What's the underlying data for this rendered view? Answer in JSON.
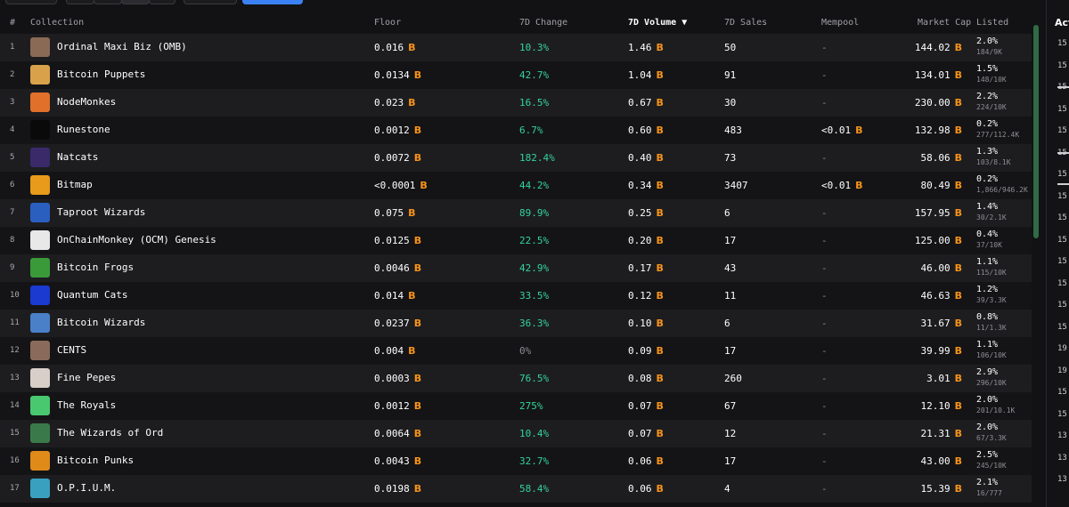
{
  "header": {
    "idx": "#",
    "collection": "Collection",
    "floor": "Floor",
    "change": "7D Change",
    "volume": "7D Volume",
    "sort_arrow": "▼",
    "sales": "7D Sales",
    "mempool": "Mempool",
    "mcap": "Market Cap",
    "listed": "Listed"
  },
  "btc_symbol": "B",
  "rows": [
    {
      "idx": "1",
      "name": "Ordinal Maxi Biz (OMB)",
      "floor": "0.016",
      "change": "10.3%",
      "volume": "1.46",
      "sales": "50",
      "mempool": "-",
      "mcap": "144.02",
      "listed": "2.0%",
      "listed_ratio": "184/9K",
      "thumb": "#8a6a55"
    },
    {
      "idx": "2",
      "name": "Bitcoin Puppets",
      "floor": "0.0134",
      "change": "42.7%",
      "volume": "1.04",
      "sales": "91",
      "mempool": "-",
      "mcap": "134.01",
      "listed": "1.5%",
      "listed_ratio": "148/10K",
      "thumb": "#d9a24a"
    },
    {
      "idx": "3",
      "name": "NodeMonkes",
      "floor": "0.023",
      "change": "16.5%",
      "volume": "0.67",
      "sales": "30",
      "mempool": "-",
      "mcap": "230.00",
      "listed": "2.2%",
      "listed_ratio": "224/10K",
      "thumb": "#e0702a"
    },
    {
      "idx": "4",
      "name": "Runestone",
      "floor": "0.0012",
      "change": "6.7%",
      "volume": "0.60",
      "sales": "483",
      "mempool": "<0.01",
      "mcap": "132.98",
      "listed": "0.2%",
      "listed_ratio": "277/112.4K",
      "thumb": "#0a0a0a"
    },
    {
      "idx": "5",
      "name": "Natcats",
      "floor": "0.0072",
      "change": "182.4%",
      "volume": "0.40",
      "sales": "73",
      "mempool": "-",
      "mcap": "58.06",
      "listed": "1.3%",
      "listed_ratio": "103/8.1K",
      "thumb": "#3a2a6a"
    },
    {
      "idx": "6",
      "name": "Bitmap",
      "floor": "<0.0001",
      "change": "44.2%",
      "volume": "0.34",
      "sales": "3407",
      "mempool": "<0.01",
      "mcap": "80.49",
      "listed": "0.2%",
      "listed_ratio": "1,866/946.2K",
      "thumb": "#e89a1a"
    },
    {
      "idx": "7",
      "name": "Taproot Wizards",
      "floor": "0.075",
      "change": "89.9%",
      "volume": "0.25",
      "sales": "6",
      "mempool": "-",
      "mcap": "157.95",
      "listed": "1.4%",
      "listed_ratio": "30/2.1K",
      "thumb": "#2a5fc0"
    },
    {
      "idx": "8",
      "name": "OnChainMonkey (OCM) Genesis",
      "floor": "0.0125",
      "change": "22.5%",
      "volume": "0.20",
      "sales": "17",
      "mempool": "-",
      "mcap": "125.00",
      "listed": "0.4%",
      "listed_ratio": "37/10K",
      "thumb": "#e8e8e8"
    },
    {
      "idx": "9",
      "name": "Bitcoin Frogs",
      "floor": "0.0046",
      "change": "42.9%",
      "volume": "0.17",
      "sales": "43",
      "mempool": "-",
      "mcap": "46.00",
      "listed": "1.1%",
      "listed_ratio": "115/10K",
      "thumb": "#3a9a3a"
    },
    {
      "idx": "10",
      "name": "Quantum Cats",
      "floor": "0.014",
      "change": "33.5%",
      "volume": "0.12",
      "sales": "11",
      "mempool": "-",
      "mcap": "46.63",
      "listed": "1.2%",
      "listed_ratio": "39/3.3K",
      "thumb": "#1a3ad0"
    },
    {
      "idx": "11",
      "name": "Bitcoin Wizards",
      "floor": "0.0237",
      "change": "36.3%",
      "volume": "0.10",
      "sales": "6",
      "mempool": "-",
      "mcap": "31.67",
      "listed": "0.8%",
      "listed_ratio": "11/1.3K",
      "thumb": "#4a80c8"
    },
    {
      "idx": "12",
      "name": "CENTS",
      "floor": "0.004",
      "change": "0%",
      "volume": "0.09",
      "sales": "17",
      "mempool": "-",
      "mcap": "39.99",
      "listed": "1.1%",
      "listed_ratio": "106/10K",
      "thumb": "#8a6a5a"
    },
    {
      "idx": "13",
      "name": "Fine Pepes",
      "floor": "0.0003",
      "change": "76.5%",
      "volume": "0.08",
      "sales": "260",
      "mempool": "-",
      "mcap": "3.01",
      "listed": "2.9%",
      "listed_ratio": "296/10K",
      "thumb": "#d8d0c8"
    },
    {
      "idx": "14",
      "name": "The Royals",
      "floor": "0.0012",
      "change": "275%",
      "volume": "0.07",
      "sales": "67",
      "mempool": "-",
      "mcap": "12.10",
      "listed": "2.0%",
      "listed_ratio": "201/10.1K",
      "thumb": "#4ac870"
    },
    {
      "idx": "15",
      "name": "The Wizards of Ord",
      "floor": "0.0064",
      "change": "10.4%",
      "volume": "0.07",
      "sales": "12",
      "mempool": "-",
      "mcap": "21.31",
      "listed": "2.0%",
      "listed_ratio": "67/3.3K",
      "thumb": "#3a7a4a"
    },
    {
      "idx": "16",
      "name": "Bitcoin Punks",
      "floor": "0.0043",
      "change": "32.7%",
      "volume": "0.06",
      "sales": "17",
      "mempool": "-",
      "mcap": "43.00",
      "listed": "2.5%",
      "listed_ratio": "245/10K",
      "thumb": "#e08a1a"
    },
    {
      "idx": "17",
      "name": "O.P.I.U.M.",
      "floor": "0.0198",
      "change": "58.4%",
      "volume": "0.06",
      "sales": "4",
      "mempool": "-",
      "mcap": "15.39",
      "listed": "2.1%",
      "listed_ratio": "16/777",
      "thumb": "#3aa0c0"
    }
  ],
  "right_pane": {
    "title": "Act",
    "items": [
      "15",
      "15",
      "15",
      "15",
      "15",
      "15",
      "15",
      "15",
      "15",
      "15",
      "15",
      "15",
      "15",
      "15",
      "19",
      "19",
      "15",
      "15",
      "13",
      "13",
      "13"
    ]
  }
}
